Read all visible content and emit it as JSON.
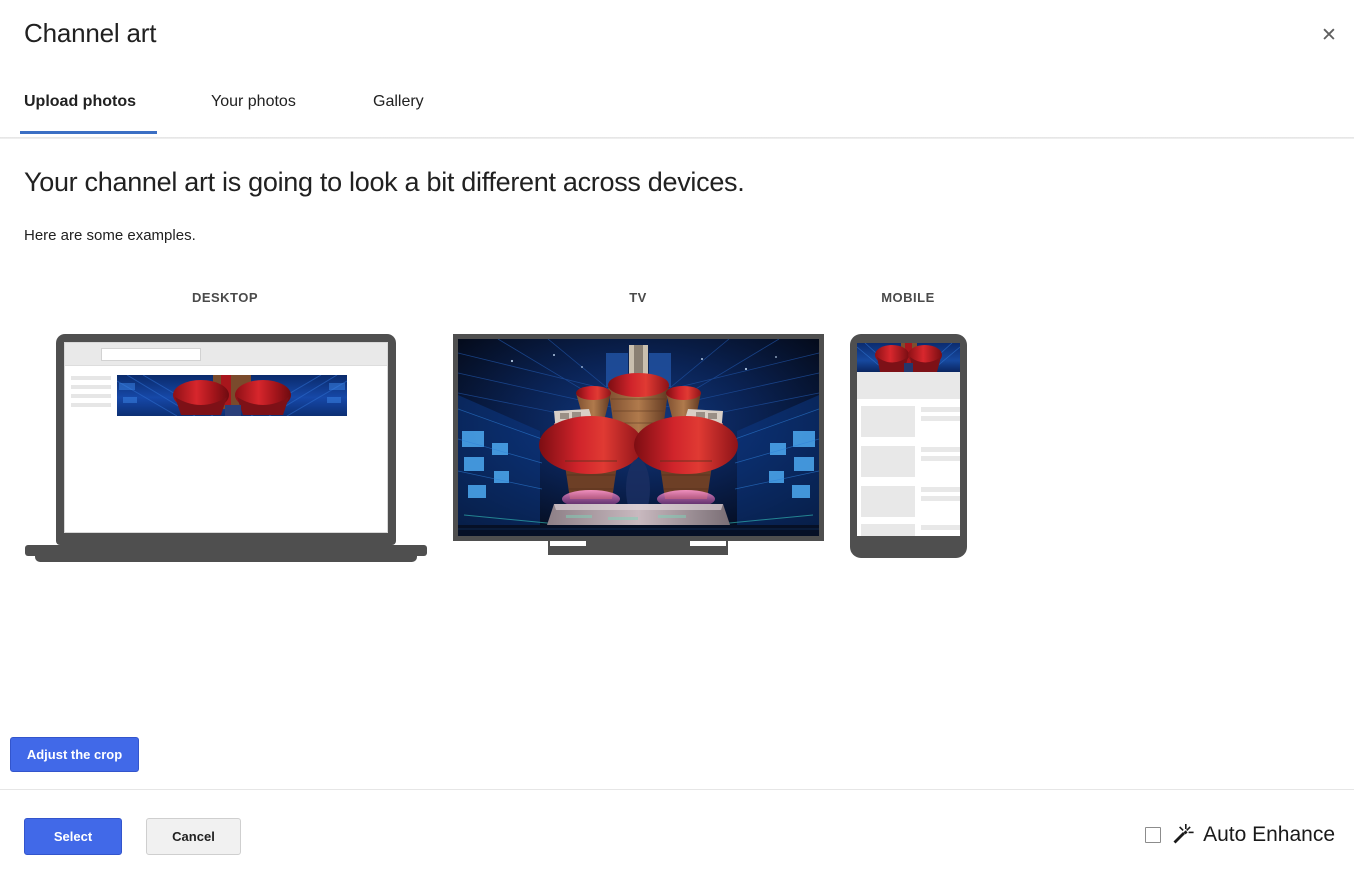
{
  "dialog": {
    "title": "Channel art",
    "close_icon": "close-icon"
  },
  "tabs": [
    {
      "label": "Upload photos",
      "active": true
    },
    {
      "label": "Your photos",
      "active": false
    },
    {
      "label": "Gallery",
      "active": false
    }
  ],
  "body": {
    "heading": "Your channel art is going to look a bit different across devices.",
    "subheading": "Here are some examples."
  },
  "previews": [
    {
      "label": "DESKTOP",
      "device": "laptop"
    },
    {
      "label": "TV",
      "device": "television"
    },
    {
      "label": "MOBILE",
      "device": "phone"
    }
  ],
  "actions": {
    "adjust_crop": "Adjust the crop",
    "select": "Select",
    "cancel": "Cancel"
  },
  "auto_enhance": {
    "label": "Auto Enhance",
    "icon": "magic-wand-icon",
    "checked": false
  },
  "colors": {
    "accent_blue": "#4169e8",
    "tab_underline": "#3b6fc4",
    "device_gray": "#4f4f4f",
    "placeholder_gray": "#e8e8e8",
    "art_red": "#c8232a",
    "art_blue": "#1a4f9c"
  }
}
